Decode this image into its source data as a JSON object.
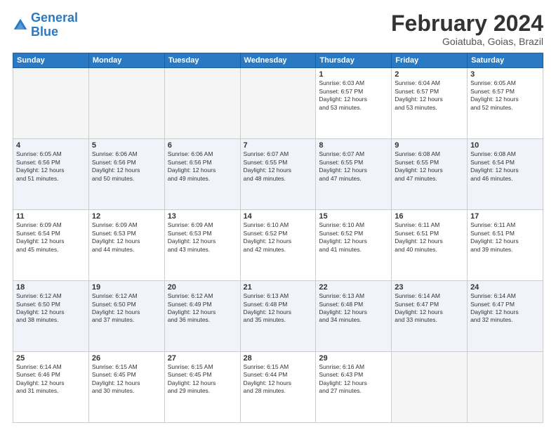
{
  "logo": {
    "line1": "General",
    "line2": "Blue"
  },
  "title": "February 2024",
  "subtitle": "Goiatuba, Goias, Brazil",
  "weekdays": [
    "Sunday",
    "Monday",
    "Tuesday",
    "Wednesday",
    "Thursday",
    "Friday",
    "Saturday"
  ],
  "weeks": [
    [
      {
        "day": "",
        "info": ""
      },
      {
        "day": "",
        "info": ""
      },
      {
        "day": "",
        "info": ""
      },
      {
        "day": "",
        "info": ""
      },
      {
        "day": "1",
        "info": "Sunrise: 6:03 AM\nSunset: 6:57 PM\nDaylight: 12 hours\nand 53 minutes."
      },
      {
        "day": "2",
        "info": "Sunrise: 6:04 AM\nSunset: 6:57 PM\nDaylight: 12 hours\nand 53 minutes."
      },
      {
        "day": "3",
        "info": "Sunrise: 6:05 AM\nSunset: 6:57 PM\nDaylight: 12 hours\nand 52 minutes."
      }
    ],
    [
      {
        "day": "4",
        "info": "Sunrise: 6:05 AM\nSunset: 6:56 PM\nDaylight: 12 hours\nand 51 minutes."
      },
      {
        "day": "5",
        "info": "Sunrise: 6:06 AM\nSunset: 6:56 PM\nDaylight: 12 hours\nand 50 minutes."
      },
      {
        "day": "6",
        "info": "Sunrise: 6:06 AM\nSunset: 6:56 PM\nDaylight: 12 hours\nand 49 minutes."
      },
      {
        "day": "7",
        "info": "Sunrise: 6:07 AM\nSunset: 6:55 PM\nDaylight: 12 hours\nand 48 minutes."
      },
      {
        "day": "8",
        "info": "Sunrise: 6:07 AM\nSunset: 6:55 PM\nDaylight: 12 hours\nand 47 minutes."
      },
      {
        "day": "9",
        "info": "Sunrise: 6:08 AM\nSunset: 6:55 PM\nDaylight: 12 hours\nand 47 minutes."
      },
      {
        "day": "10",
        "info": "Sunrise: 6:08 AM\nSunset: 6:54 PM\nDaylight: 12 hours\nand 46 minutes."
      }
    ],
    [
      {
        "day": "11",
        "info": "Sunrise: 6:09 AM\nSunset: 6:54 PM\nDaylight: 12 hours\nand 45 minutes."
      },
      {
        "day": "12",
        "info": "Sunrise: 6:09 AM\nSunset: 6:53 PM\nDaylight: 12 hours\nand 44 minutes."
      },
      {
        "day": "13",
        "info": "Sunrise: 6:09 AM\nSunset: 6:53 PM\nDaylight: 12 hours\nand 43 minutes."
      },
      {
        "day": "14",
        "info": "Sunrise: 6:10 AM\nSunset: 6:52 PM\nDaylight: 12 hours\nand 42 minutes."
      },
      {
        "day": "15",
        "info": "Sunrise: 6:10 AM\nSunset: 6:52 PM\nDaylight: 12 hours\nand 41 minutes."
      },
      {
        "day": "16",
        "info": "Sunrise: 6:11 AM\nSunset: 6:51 PM\nDaylight: 12 hours\nand 40 minutes."
      },
      {
        "day": "17",
        "info": "Sunrise: 6:11 AM\nSunset: 6:51 PM\nDaylight: 12 hours\nand 39 minutes."
      }
    ],
    [
      {
        "day": "18",
        "info": "Sunrise: 6:12 AM\nSunset: 6:50 PM\nDaylight: 12 hours\nand 38 minutes."
      },
      {
        "day": "19",
        "info": "Sunrise: 6:12 AM\nSunset: 6:50 PM\nDaylight: 12 hours\nand 37 minutes."
      },
      {
        "day": "20",
        "info": "Sunrise: 6:12 AM\nSunset: 6:49 PM\nDaylight: 12 hours\nand 36 minutes."
      },
      {
        "day": "21",
        "info": "Sunrise: 6:13 AM\nSunset: 6:48 PM\nDaylight: 12 hours\nand 35 minutes."
      },
      {
        "day": "22",
        "info": "Sunrise: 6:13 AM\nSunset: 6:48 PM\nDaylight: 12 hours\nand 34 minutes."
      },
      {
        "day": "23",
        "info": "Sunrise: 6:14 AM\nSunset: 6:47 PM\nDaylight: 12 hours\nand 33 minutes."
      },
      {
        "day": "24",
        "info": "Sunrise: 6:14 AM\nSunset: 6:47 PM\nDaylight: 12 hours\nand 32 minutes."
      }
    ],
    [
      {
        "day": "25",
        "info": "Sunrise: 6:14 AM\nSunset: 6:46 PM\nDaylight: 12 hours\nand 31 minutes."
      },
      {
        "day": "26",
        "info": "Sunrise: 6:15 AM\nSunset: 6:45 PM\nDaylight: 12 hours\nand 30 minutes."
      },
      {
        "day": "27",
        "info": "Sunrise: 6:15 AM\nSunset: 6:45 PM\nDaylight: 12 hours\nand 29 minutes."
      },
      {
        "day": "28",
        "info": "Sunrise: 6:15 AM\nSunset: 6:44 PM\nDaylight: 12 hours\nand 28 minutes."
      },
      {
        "day": "29",
        "info": "Sunrise: 6:16 AM\nSunset: 6:43 PM\nDaylight: 12 hours\nand 27 minutes."
      },
      {
        "day": "",
        "info": ""
      },
      {
        "day": "",
        "info": ""
      }
    ]
  ]
}
